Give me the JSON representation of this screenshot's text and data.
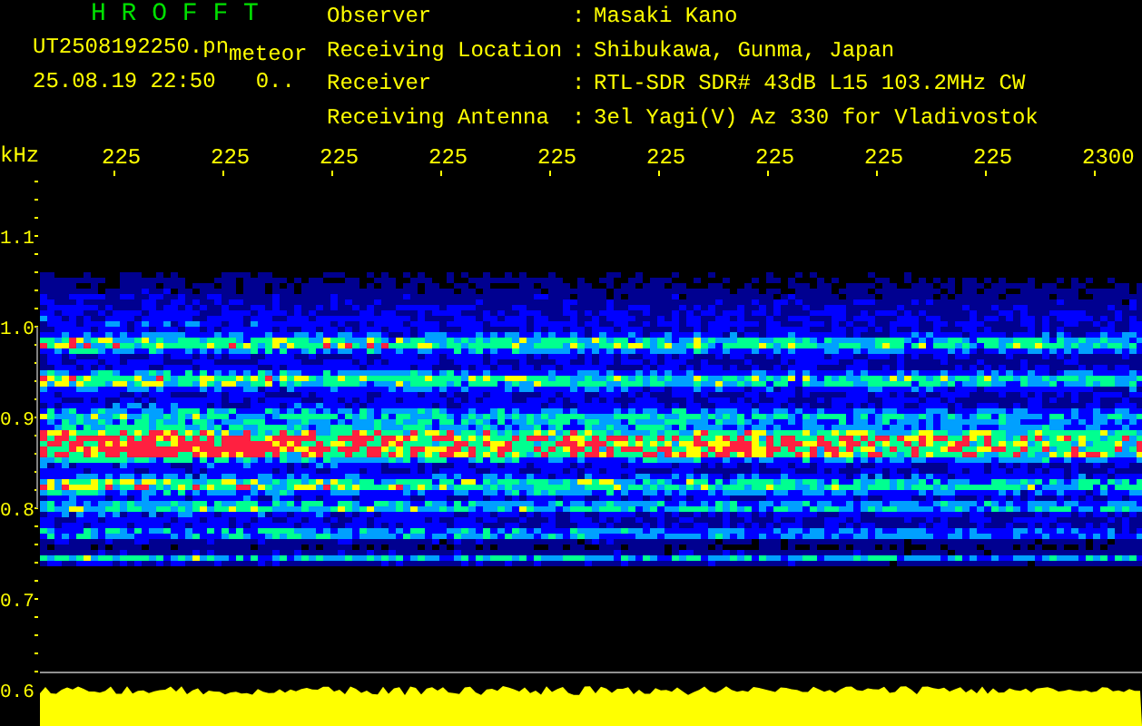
{
  "app": {
    "title": "H R O F F T",
    "filename": "UT2508192250.pn",
    "mode": "meteor",
    "timestamp": "25.08.19 22:50",
    "counter": "0.."
  },
  "station_info": [
    {
      "label": "Observer",
      "separator": ":",
      "value": "Masaki Kano"
    },
    {
      "label": "Receiving Location",
      "separator": ":",
      "value": "Shibukawa, Gunma, Japan"
    },
    {
      "label": "Receiver",
      "separator": ":",
      "value": "RTL-SDR SDR# 43dB L15 103.2MHz CW"
    },
    {
      "label": "Receiving Antenna",
      "separator": ":",
      "value": "3el Yagi(V) Az 330 for Vladivostok"
    }
  ],
  "spectrogram": {
    "unit": "kHz",
    "time_labels": [
      "225",
      "225",
      "225",
      "225",
      "225",
      "225",
      "225",
      "225",
      "225",
      "2300"
    ],
    "frequency_labels": [
      "1.1",
      "1.0",
      "0.9",
      "0.8",
      "0.7",
      "0.6"
    ]
  }
}
